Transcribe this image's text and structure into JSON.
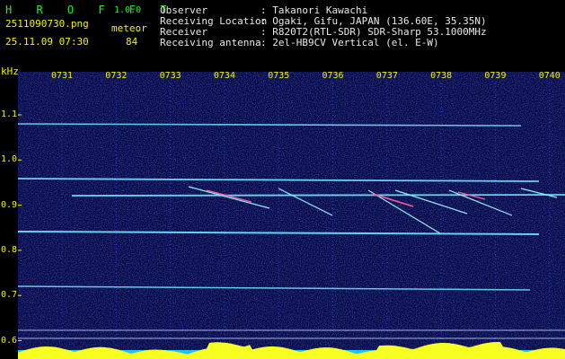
{
  "header": {
    "app_name": "H R O F F T",
    "version": "1.0.0",
    "filename": "2511090730.png",
    "datetime": "25.11.09 07:30",
    "meteor_label": "meteor",
    "meteor_count": "84",
    "info_keys": [
      "Observer",
      "Receiving Location",
      "Receiver",
      "Receiving antenna"
    ],
    "info_values": [
      ": Takanori Kawachi",
      ": Ogaki, Gifu, JAPAN (136.60E, 35.35N)",
      ": R820T2(RTL-SDR) SDR-Sharp 53.1000MHz",
      ": 2el-HB9CV Vertical (el. E-W)"
    ]
  },
  "chart_data": {
    "type": "spectrogram",
    "ylabel": "kHz",
    "y_ticks": [
      "1.1",
      "1.0",
      "0.9",
      "0.8",
      "0.7",
      "0.6"
    ],
    "x_ticks": [
      "0731",
      "0732",
      "0733",
      "0734",
      "0735",
      "0736",
      "0737",
      "0738",
      "0739",
      "0740"
    ],
    "colors": {
      "background": "#050538",
      "noise": "#1c2cff",
      "signal": "#6ee9ff",
      "meteor": "#ff5aa0",
      "amplitude": "#f7ff20"
    }
  }
}
